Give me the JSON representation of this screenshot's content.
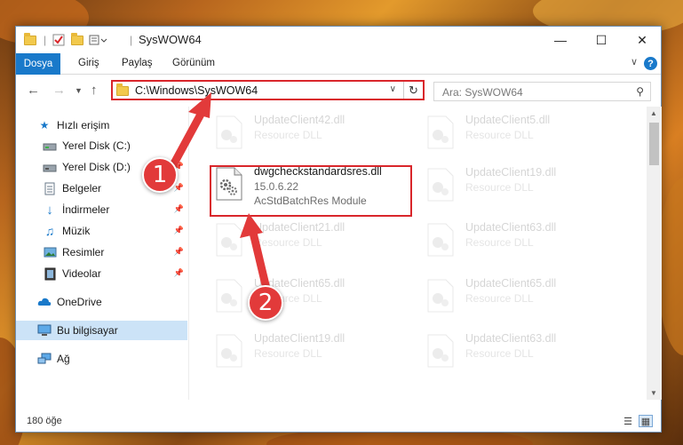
{
  "window": {
    "title": "SysWOW64",
    "controls": {
      "minimize": "—",
      "maximize": "☐",
      "close": "✕"
    }
  },
  "ribbon": {
    "file_tab": "Dosya",
    "tabs": [
      "Giriş",
      "Paylaş",
      "Görünüm"
    ],
    "help": "?"
  },
  "nav": {
    "address": "C:\\Windows\\SysWOW64",
    "search_placeholder": "Ara: SysWOW64"
  },
  "sidebar": {
    "items": [
      {
        "label": "Hızlı erişim",
        "icon": "star-icon",
        "pinned": false
      },
      {
        "label": "Yerel Disk (C:)",
        "icon": "drive-icon",
        "pinned": false
      },
      {
        "label": "Yerel Disk (D:)",
        "icon": "drive-icon",
        "pinned": true
      },
      {
        "label": "Belgeler",
        "icon": "document-icon",
        "pinned": true
      },
      {
        "label": "İndirmeler",
        "icon": "download-icon",
        "pinned": true
      },
      {
        "label": "Müzik",
        "icon": "music-icon",
        "pinned": true
      },
      {
        "label": "Resimler",
        "icon": "pictures-icon",
        "pinned": true
      },
      {
        "label": "Videolar",
        "icon": "video-icon",
        "pinned": true
      },
      {
        "label": "OneDrive",
        "icon": "cloud-icon",
        "pinned": false
      },
      {
        "label": "Bu bilgisayar",
        "icon": "computer-icon",
        "pinned": false,
        "selected": true
      },
      {
        "label": "Ağ",
        "icon": "network-icon",
        "pinned": false
      }
    ]
  },
  "files": {
    "highlighted": {
      "name": "dwgcheckstandardsres.dll",
      "version": "15.0.6.22",
      "description": "AcStdBatchRes Module"
    },
    "faded": [
      {
        "name": "UpdateClient42.dll",
        "desc": "Resource DLL"
      },
      {
        "name": "UpdateClient5.dll",
        "desc": "Resource DLL"
      },
      {
        "name": "UpdateClient19.dll",
        "desc": "Resource DLL"
      },
      {
        "name": "UpdateClient21.dll",
        "desc": "Resource DLL"
      },
      {
        "name": "UpdateClient63.dll",
        "desc": "Resource DLL"
      },
      {
        "name": "UpdateClient65.dll",
        "desc": "Resource DLL"
      },
      {
        "name": "UpdateClient65.dll",
        "desc": "Resource DLL"
      },
      {
        "name": "UpdateClient19.dll",
        "desc": "Resource DLL"
      },
      {
        "name": "UpdateClient63.dll",
        "desc": "Resource DLL"
      }
    ]
  },
  "status": {
    "item_count": "180 öğe"
  },
  "callouts": {
    "one": "1",
    "two": "2"
  },
  "colors": {
    "accent": "#1979ca",
    "highlight": "#d9262b",
    "callout": "#e23a3a",
    "selection": "#cce3f7"
  }
}
